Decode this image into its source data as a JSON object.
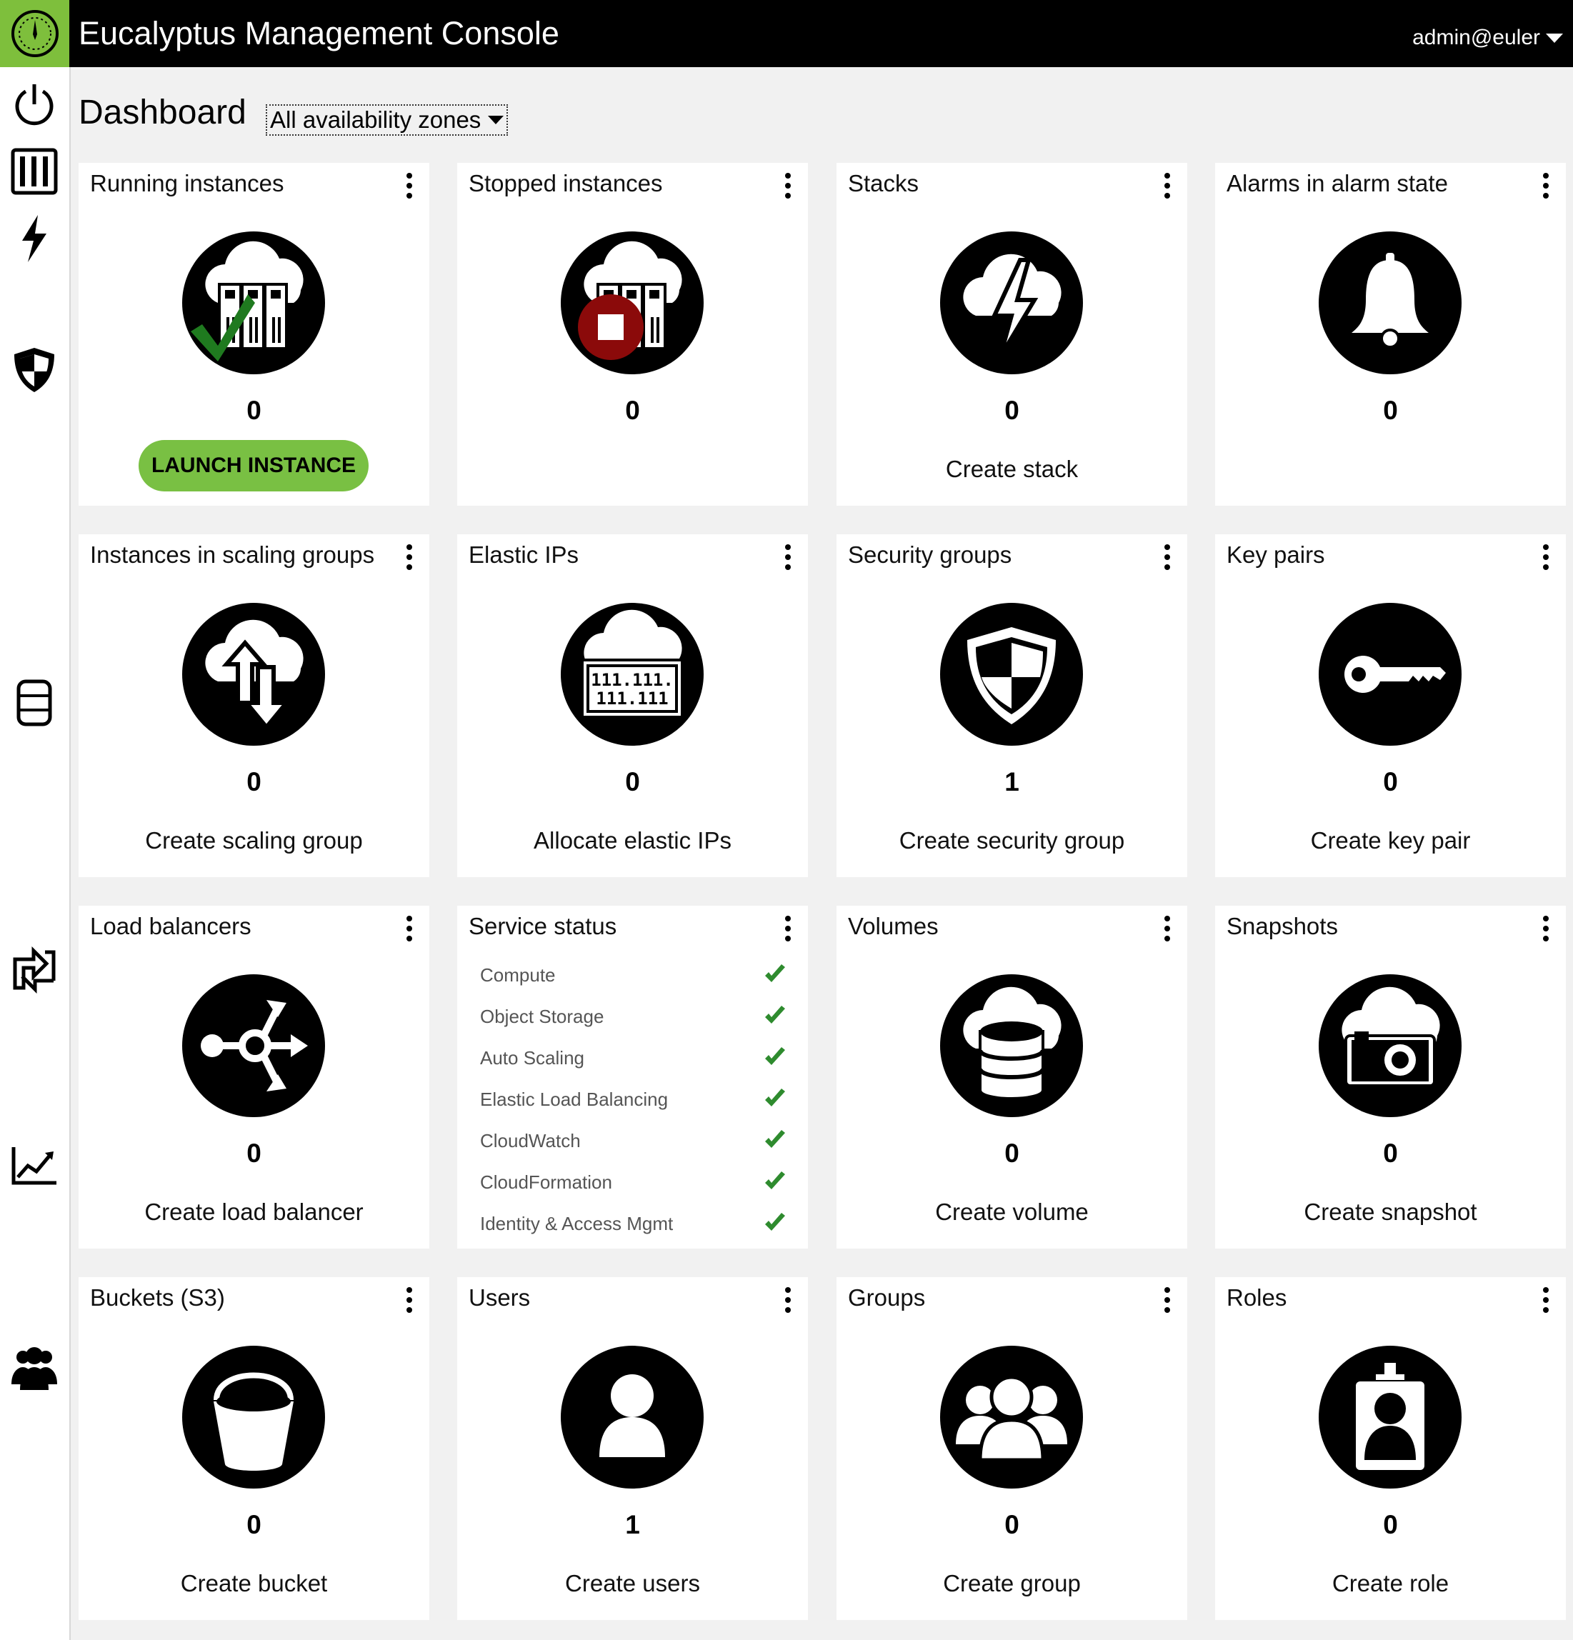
{
  "app": {
    "title": "Eucalyptus Management Console",
    "user": "admin@euler"
  },
  "page": {
    "title": "Dashboard",
    "zone_selector": "All availability zones"
  },
  "sidebar": {
    "items": [
      {
        "name": "dashboard",
        "icon": "power-icon"
      },
      {
        "name": "images",
        "icon": "server-rack-icon"
      },
      {
        "name": "stacks",
        "icon": "lightning-icon"
      },
      {
        "name": "security",
        "icon": "shield-icon"
      },
      {
        "name": "storage",
        "icon": "database-icon"
      },
      {
        "name": "scaling",
        "icon": "transfer-icon"
      },
      {
        "name": "monitoring",
        "icon": "chart-icon"
      },
      {
        "name": "identity",
        "icon": "users-icon"
      }
    ]
  },
  "colors": {
    "accent": "#79c043",
    "check": "#2e8b2e",
    "stop": "#8b0a0a"
  },
  "tiles": {
    "running_instances": {
      "title": "Running instances",
      "count": "0",
      "action": "LAUNCH INSTANCE"
    },
    "stopped_instances": {
      "title": "Stopped instances",
      "count": "0"
    },
    "stacks": {
      "title": "Stacks",
      "count": "0",
      "action": "Create stack"
    },
    "alarms": {
      "title": "Alarms in alarm state",
      "count": "0"
    },
    "scaling_instances": {
      "title": "Instances in scaling groups",
      "count": "0",
      "action": "Create scaling group"
    },
    "elastic_ips": {
      "title": "Elastic IPs",
      "count": "0",
      "action": "Allocate elastic IPs",
      "icon_text_1": "111.111.",
      "icon_text_2": "111.111"
    },
    "security_groups": {
      "title": "Security groups",
      "count": "1",
      "action": "Create security group"
    },
    "key_pairs": {
      "title": "Key pairs",
      "count": "0",
      "action": "Create key pair"
    },
    "load_balancers": {
      "title": "Load balancers",
      "count": "0",
      "action": "Create load balancer"
    },
    "service_status": {
      "title": "Service status",
      "services": [
        "Compute",
        "Object Storage",
        "Auto Scaling",
        "Elastic Load Balancing",
        "CloudWatch",
        "CloudFormation",
        "Identity & Access Mgmt"
      ]
    },
    "volumes": {
      "title": "Volumes",
      "count": "0",
      "action": "Create volume"
    },
    "snapshots": {
      "title": "Snapshots",
      "count": "0",
      "action": "Create snapshot"
    },
    "buckets": {
      "title": "Buckets (S3)",
      "count": "0",
      "action": "Create bucket"
    },
    "users": {
      "title": "Users",
      "count": "1",
      "action": "Create users"
    },
    "groups": {
      "title": "Groups",
      "count": "0",
      "action": "Create group"
    },
    "roles": {
      "title": "Roles",
      "count": "0",
      "action": "Create role"
    }
  }
}
